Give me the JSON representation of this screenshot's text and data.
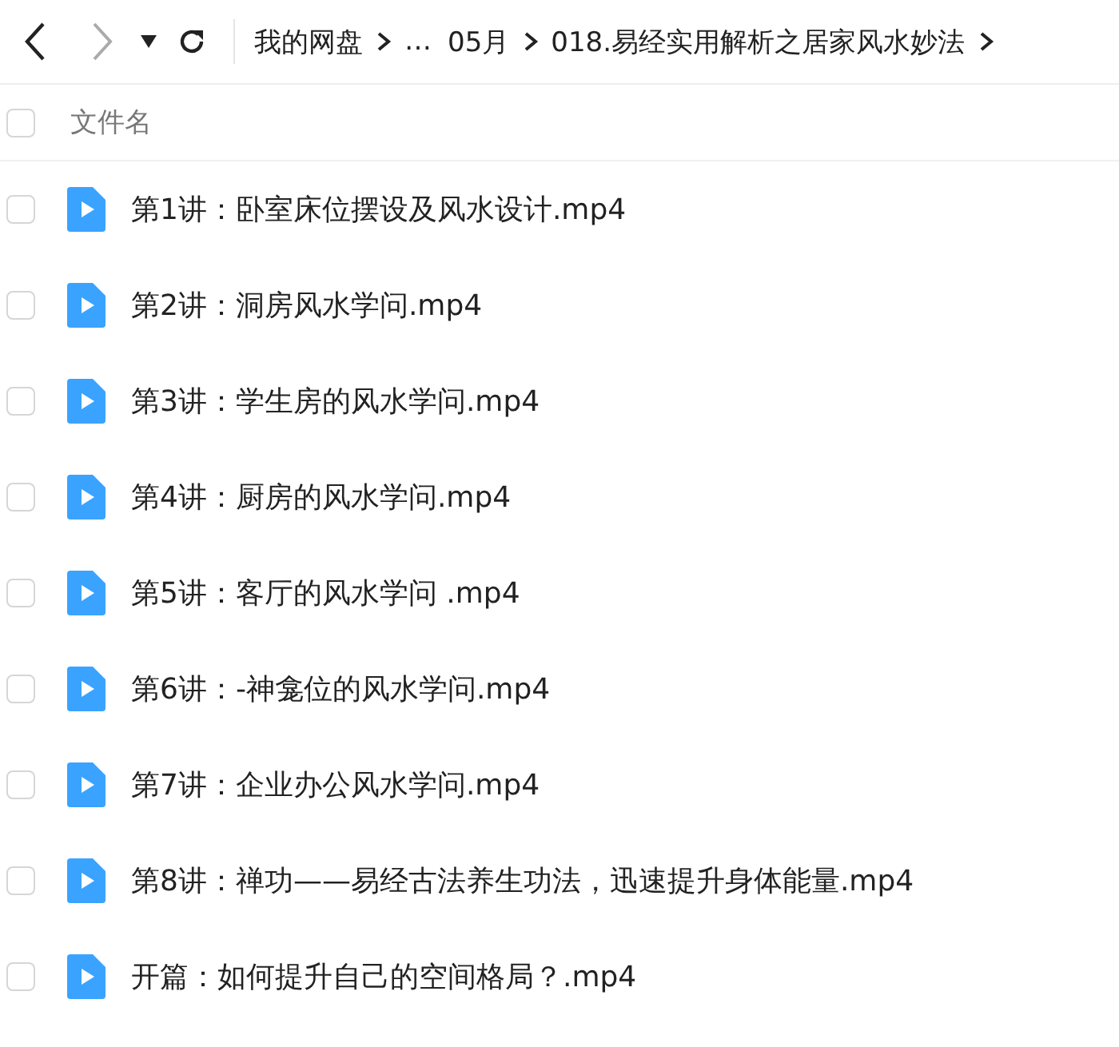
{
  "nav": {
    "back_disabled": false,
    "forward_disabled": true
  },
  "breadcrumb": [
    "我的网盘",
    "…",
    "05月",
    "018.易经实用解析之居家风水妙法"
  ],
  "header": {
    "label": "文件名",
    "checked": false
  },
  "files": [
    {
      "name": "第1讲：卧室床位摆设及风水设计.mp4",
      "checked": false
    },
    {
      "name": "第2讲：洞房风水学问.mp4",
      "checked": false
    },
    {
      "name": "第3讲：学生房的风水学问.mp4",
      "checked": false
    },
    {
      "name": "第4讲：厨房的风水学问.mp4",
      "checked": false
    },
    {
      "name": "第5讲：客厅的风水学问 .mp4",
      "checked": false
    },
    {
      "name": "第6讲：-神龛位的风水学问.mp4",
      "checked": false
    },
    {
      "name": "第7讲：企业办公风水学问.mp4",
      "checked": false
    },
    {
      "name": "第8讲：禅功——易经古法养生功法，迅速提升身体能量.mp4",
      "checked": false
    },
    {
      "name": "开篇：如何提升自己的空间格局？.mp4",
      "checked": false
    }
  ]
}
